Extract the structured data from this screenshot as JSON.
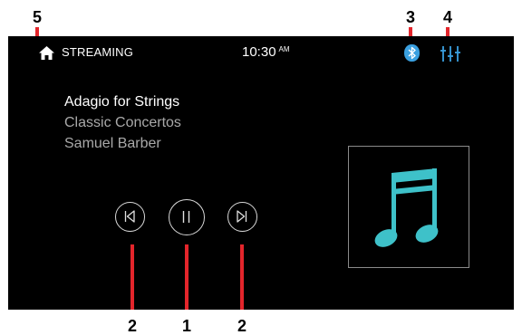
{
  "status_bar": {
    "source": "STREAMING",
    "time": "10:30",
    "ampm": "AM",
    "home_icon": "home-icon",
    "bluetooth_icon": "bluetooth-icon",
    "equalizer_icon": "equalizer-icon"
  },
  "now_playing": {
    "title": "Adagio for Strings",
    "album": "Classic Concertos",
    "artist": "Samuel Barber"
  },
  "controls": {
    "previous_icon": "skip-previous-icon",
    "pause_icon": "pause-icon",
    "next_icon": "skip-next-icon"
  },
  "album_art_icon": "music-note-icon",
  "callouts": {
    "home": "5",
    "bluetooth": "3",
    "equalizer": "4",
    "previous": "2",
    "pause": "1",
    "next": "2"
  },
  "colors": {
    "accent": "#3aa0e0",
    "art": "#3ec1c9",
    "callout_line": "#e3252b",
    "background": "#000000"
  }
}
